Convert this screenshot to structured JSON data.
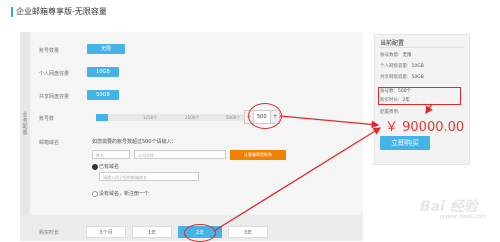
{
  "header": {
    "title": "企业邮箱尊享版-无限容量"
  },
  "vertical_tab": {
    "label": "业务配置"
  },
  "form": {
    "accounts_label": "账号数量",
    "accounts_value": "无限",
    "personal_storage_label": "个人网盘容量",
    "personal_storage_value": "10GB",
    "shared_storage_label": "共享网盘容量",
    "shared_storage_value": "50GB",
    "account_count_label": "账号数",
    "slider_ticks": [
      "1250个",
      "2500个",
      "5000个"
    ],
    "account_count_value": "500",
    "domain_label": "邮箱域名",
    "domain_note": "如您需要的帐号数超过500个请输入：",
    "name_placeholder": "姓名",
    "company_placeholder": "公司名称",
    "contact_button": "让客服帮您联系",
    "has_domain_option": "已有域名",
    "domain_input_placeholder": "请输入用于您的邮箱域名",
    "no_domain_option": "没有域名，新注册一个",
    "duration_label": "购买时长",
    "duration_options": [
      "3个月",
      "1年",
      "2年",
      "3年"
    ],
    "duration_selected_index": 2
  },
  "summary": {
    "title": "当前配置",
    "rows": [
      {
        "label": "账号数量:",
        "value": "无限"
      },
      {
        "label": "个人网盘容量:",
        "value": "10GB"
      },
      {
        "label": "共享网盘容量:",
        "value": "50GB"
      },
      {
        "label": "账号数:",
        "value": "500个"
      },
      {
        "label": "购买时长:",
        "value": "2年"
      }
    ],
    "fee_label": "配置费用:",
    "price": "￥ 90000.00",
    "buy_button": "立即购买"
  },
  "watermark": {
    "text": "Bai 经验",
    "sub": "jingyan.baidu.com"
  },
  "colors": {
    "accent": "#45b3e7",
    "annotation": "#e02a2a",
    "price": "#e53a2e",
    "orange": "#f08200"
  }
}
